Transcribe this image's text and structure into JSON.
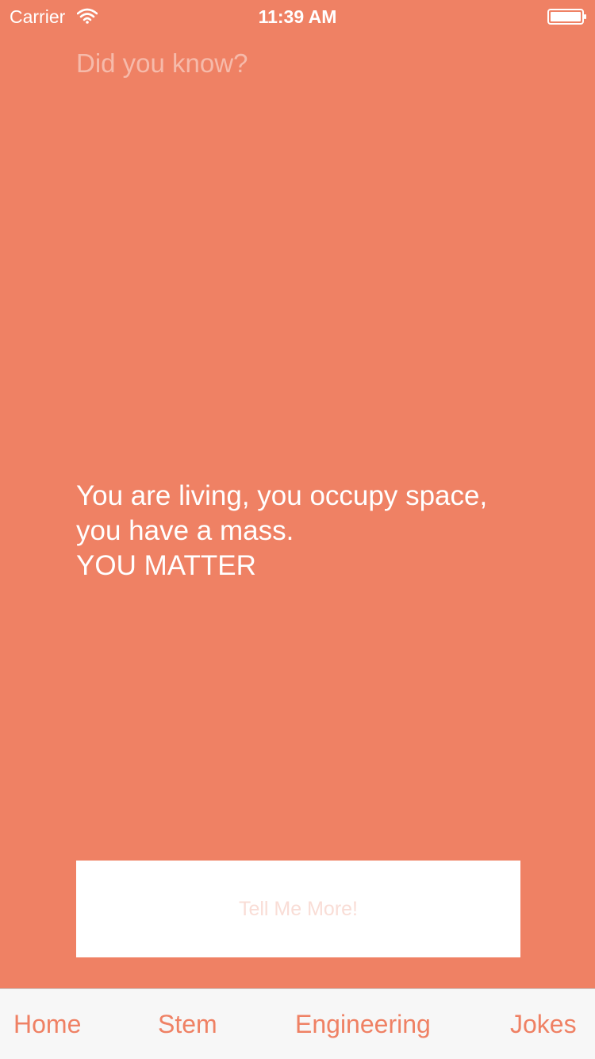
{
  "status_bar": {
    "carrier": "Carrier",
    "time": "11:39 AM",
    "wifi_icon": "wifi-icon",
    "battery_icon": "battery-icon"
  },
  "main": {
    "heading": "Did you know?",
    "fact_lines": [
      "You are living, you occupy space,",
      "you have a mass.",
      "YOU MATTER"
    ],
    "button_label": "Tell Me More!"
  },
  "tab_bar": {
    "tabs": [
      {
        "label": "Home"
      },
      {
        "label": "Stem"
      },
      {
        "label": "Engineering"
      },
      {
        "label": "Jokes"
      }
    ]
  },
  "colors": {
    "background": "#EF8164",
    "button_background": "#FFFFFF",
    "button_text": "#F9DDD6",
    "tab_text": "#EF8164",
    "tab_bar_background": "#F7F7F7"
  }
}
